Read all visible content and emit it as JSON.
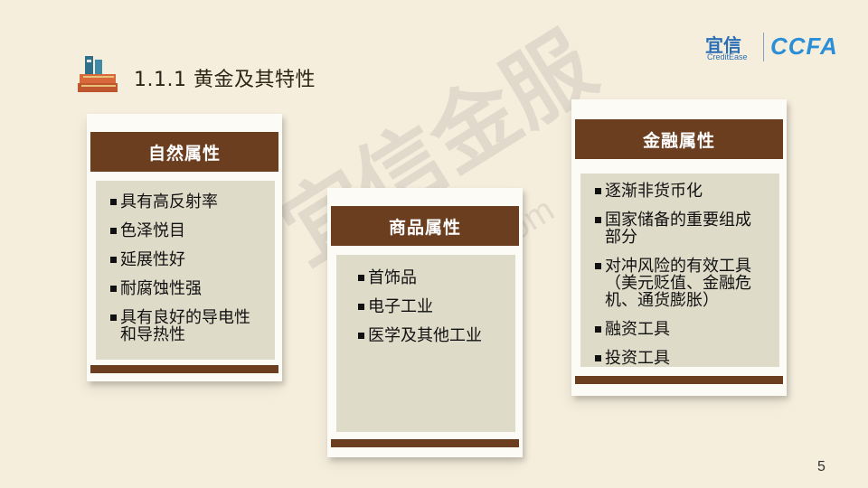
{
  "header": {
    "title": "1.1.1 黄金及其特性",
    "logo_text": "宜信",
    "logo_subtext": "CreditEase",
    "logo_mark": "CCFA"
  },
  "watermark": {
    "main": "宜信金服",
    "sub": "xinguo.yixin.com"
  },
  "cards": [
    {
      "title": "自然属性",
      "items": [
        "具有高反射率",
        "色泽悦目",
        "延展性好",
        "耐腐蚀性强",
        "具有良好的导电性\n和导热性"
      ]
    },
    {
      "title": "商品属性",
      "items": [
        "首饰品",
        "电子工业",
        "医学及其他工业"
      ]
    },
    {
      "title": "金融属性",
      "items": [
        "逐渐非货币化",
        "国家储备的重要组成\n部分",
        "对冲风险的有效工具\n（美元贬值、金融危\n机、通货膨胀）",
        "融资工具",
        "投资工具"
      ]
    }
  ],
  "page": {
    "number": "5"
  },
  "colors": {
    "background": "#f6eedd",
    "header_bar": "#6b3e20",
    "body_panel": "#dedbc9",
    "logo_blue": "#2a8fd6"
  },
  "icons": {
    "title_icon": "books-icon"
  }
}
